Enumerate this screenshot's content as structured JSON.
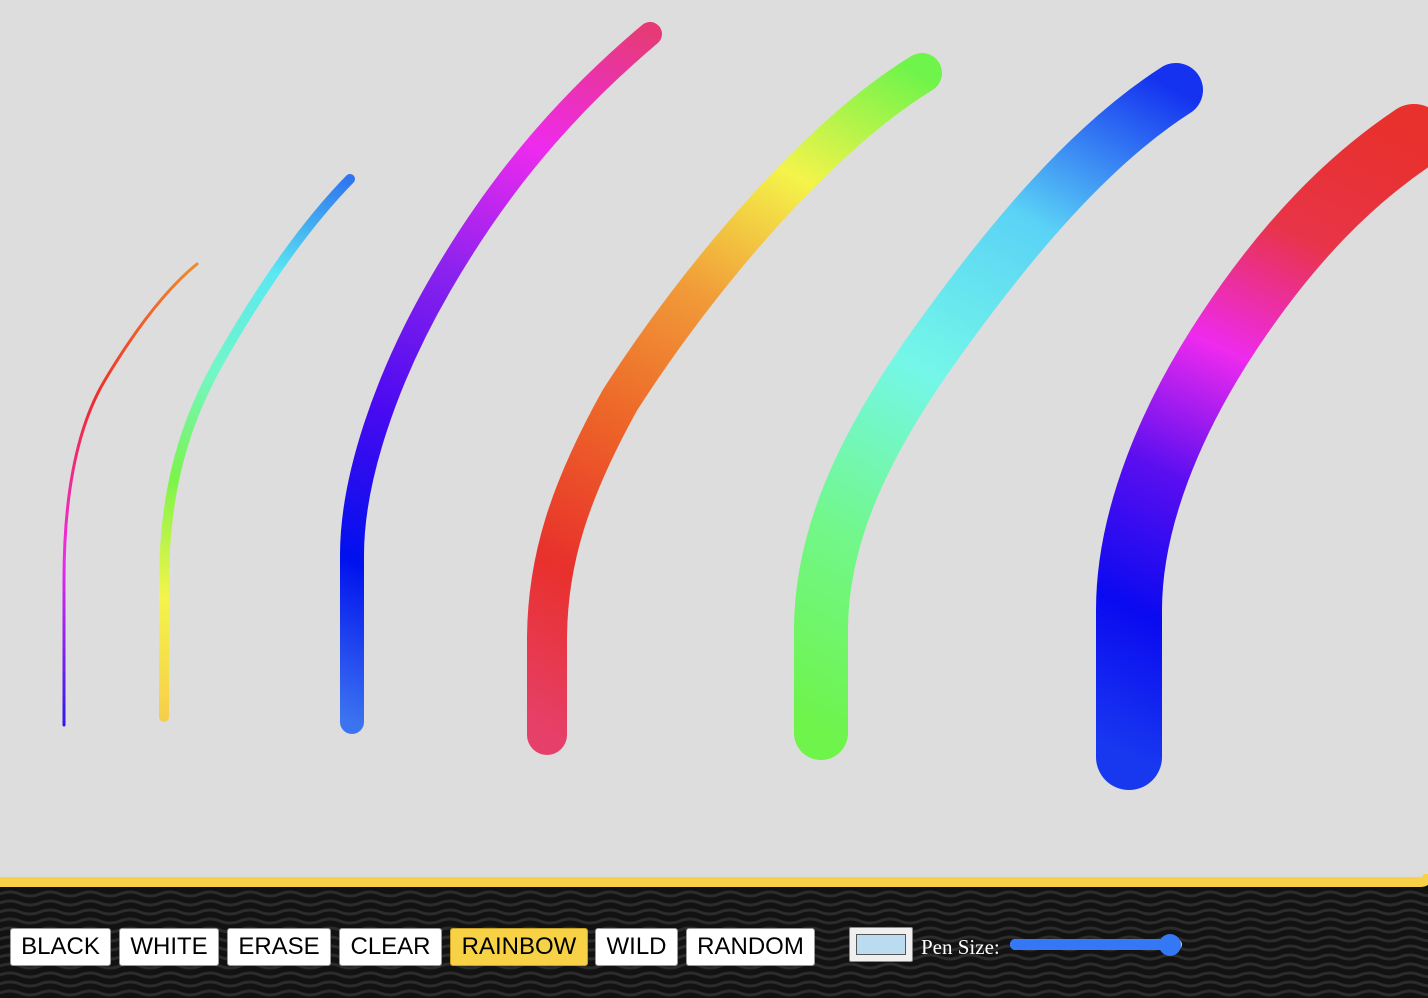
{
  "canvas": {
    "background": "#dddddd",
    "border_color": "#f7d247",
    "strokes": [
      {
        "stroke": "stroke-1",
        "colors": [
          "#2c19ee",
          "#ee2aee",
          "#ee2c2c",
          "#f08a2c"
        ]
      },
      {
        "stroke": "stroke-2",
        "colors": [
          "#f6cf4a",
          "#f4f44a",
          "#7bf44a",
          "#72f7c6",
          "#5ae8f2",
          "#2f74f0"
        ]
      },
      {
        "stroke": "stroke-3",
        "colors": [
          "#3c73f0",
          "#0010ee",
          "#4a0af0",
          "#8a22ee",
          "#ee2aee",
          "#e63a78"
        ]
      },
      {
        "stroke": "stroke-4",
        "colors": [
          "#e6406a",
          "#e8302c",
          "#ed6428",
          "#f19a38",
          "#f4f44a",
          "#6ef44a"
        ]
      },
      {
        "stroke": "stroke-5",
        "colors": [
          "#6ef44a",
          "#72f78a",
          "#74f7e8",
          "#5ad2f6",
          "#1432f0"
        ]
      },
      {
        "stroke": "stroke-6",
        "colors": [
          "#1838f0",
          "#0a0af0",
          "#5a0ef0",
          "#ee2aee",
          "#e83448",
          "#e8302c"
        ]
      }
    ]
  },
  "toolbar": {
    "buttons": [
      {
        "name": "black-button",
        "label": "BLACK",
        "active": false
      },
      {
        "name": "white-button",
        "label": "WHITE",
        "active": false
      },
      {
        "name": "erase-button",
        "label": "ERASE",
        "active": false
      },
      {
        "name": "clear-button",
        "label": "CLEAR",
        "active": false
      },
      {
        "name": "rainbow-button",
        "label": "RAINBOW",
        "active": true
      },
      {
        "name": "wild-button",
        "label": "WILD",
        "active": false
      },
      {
        "name": "random-button",
        "label": "RANDOM",
        "active": false
      }
    ],
    "color_picker_value": "#bbdcf0",
    "pen_size_label": "Pen Size:",
    "pen_size_fraction": 0.93,
    "slider_color": "#3478f6",
    "active_color": "#f7d247"
  }
}
